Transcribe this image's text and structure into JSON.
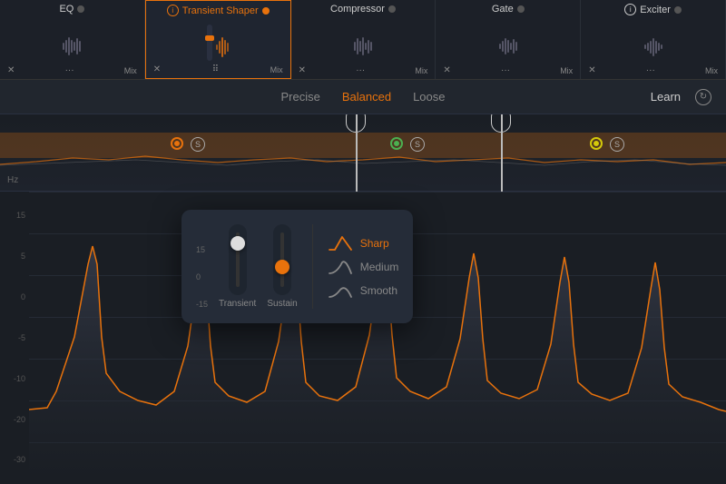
{
  "pluginBar": {
    "plugins": [
      {
        "id": "eq",
        "name": "EQ",
        "active": false
      },
      {
        "id": "transient",
        "name": "Transient Shaper",
        "active": true
      },
      {
        "id": "compressor",
        "name": "Compressor",
        "active": false
      },
      {
        "id": "gate",
        "name": "Gate",
        "active": false
      },
      {
        "id": "exciter",
        "name": "Exciter",
        "active": false
      }
    ]
  },
  "controlBar": {
    "tabs": [
      {
        "id": "precise",
        "label": "Precise",
        "active": false
      },
      {
        "id": "balanced",
        "label": "Balanced",
        "active": true
      },
      {
        "id": "loose",
        "label": "Loose",
        "active": false
      }
    ],
    "learn_label": "Learn"
  },
  "popup": {
    "transient_label": "Transient",
    "sustain_label": "Sustain",
    "scale": {
      "top": "15",
      "mid": "0",
      "bot": "-15"
    },
    "shapes": [
      {
        "id": "sharp",
        "label": "Sharp",
        "active": true
      },
      {
        "id": "medium",
        "label": "Medium",
        "active": false
      },
      {
        "id": "smooth",
        "label": "Smooth",
        "active": false
      }
    ]
  },
  "yAxis": {
    "labels": [
      "15",
      "5",
      "0",
      "-5",
      "-10",
      "-20",
      "-30"
    ]
  },
  "freqLabel": "Hz"
}
